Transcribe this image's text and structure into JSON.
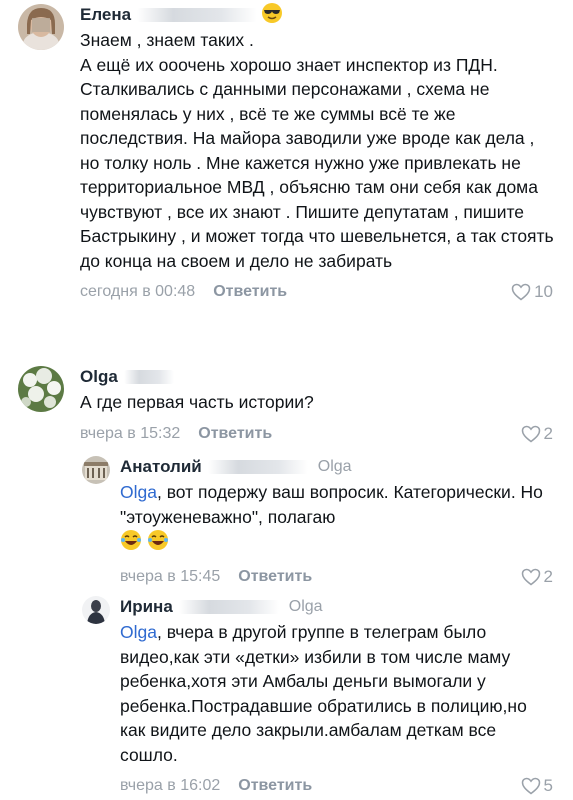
{
  "comments": [
    {
      "author": "Елена",
      "text": [
        "Знаем , знаем таких .",
        "А ещё их ооочень хорошо знает инспектор из ПДН.",
        "Сталкивались с данными персонажами , схема не поменялась у них , всё те же суммы всё те же последствия. На майора заводили уже вроде как дела , но толку ноль . Мне кажется нужно уже привлекать не территориальное МВД , объясню там они себя как дома чувствуют , все их знают . Пишите депутатам , пишите Бастрыкину , и может тогда что шевельнется, а так стоять до конца на своем и дело не забирать"
      ],
      "date": "сегодня в 00:48",
      "reply_label": "Ответить",
      "likes": "10",
      "avatar_icon": "person-photo-blurred",
      "badge_icon": "sunglasses-emoji"
    },
    {
      "author": "Olga",
      "text": [
        "А где первая часть истории?"
      ],
      "date": "вчера в 15:32",
      "reply_label": "Ответить",
      "likes": "2",
      "avatar_icon": "flowers-photo"
    },
    {
      "author": "Анатолий",
      "reply_to": "Olga",
      "mention": "Olga",
      "text_after_mention": ", вот подержу ваш вопросик. Категорически. Но \"этоуженеважно\", полагаю",
      "emoji_icons": [
        "laughing-tears-emoji",
        "laughing-tears-emoji"
      ],
      "date": "вчера в 15:45",
      "reply_label": "Ответить",
      "likes": "2",
      "avatar_icon": "building-photo"
    },
    {
      "author": "Ирина",
      "reply_to": "Olga",
      "mention": "Olga",
      "text_after_mention": ", вчера в другой группе в телеграм было видео,как эти «детки» избили в том числе маму ребенка,хотя эти Амбалы деньги вымогали у ребенка.Пострадавшие обратились в полицию,но как видите дело закрыли.амбалам деткам все сошло.",
      "date": "вчера в 16:02",
      "reply_label": "Ответить",
      "likes": "5",
      "avatar_icon": "person-photo"
    }
  ],
  "colors": {
    "text": "#101418",
    "meta": "#9aa1a9",
    "reply_link": "#8c96a2",
    "mention": "#2f6ad0",
    "author": "#1f2a36"
  }
}
